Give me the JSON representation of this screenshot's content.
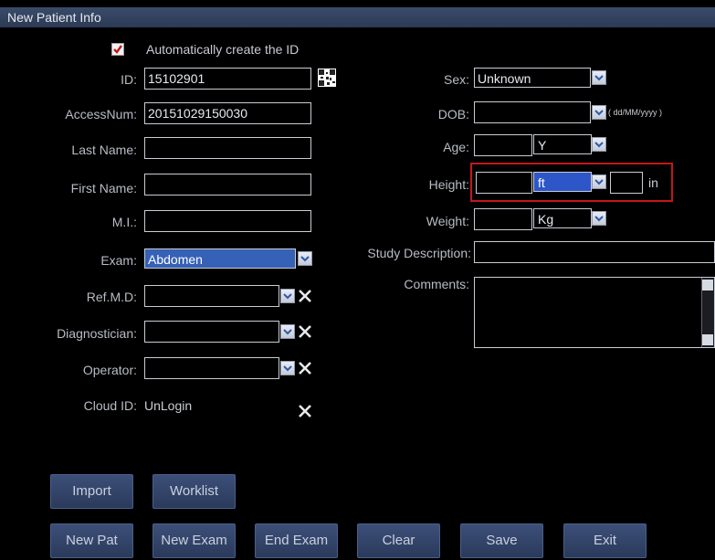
{
  "window": {
    "title": "New Patient Info"
  },
  "auto_id": {
    "label": "Automatically create the ID",
    "checked": true
  },
  "left": {
    "id": {
      "label": "ID:",
      "value": "15102901"
    },
    "access_num": {
      "label": "AccessNum:",
      "value": "20151029150030"
    },
    "last_name": {
      "label": "Last Name:",
      "value": ""
    },
    "first_name": {
      "label": "First Name:",
      "value": ""
    },
    "mi": {
      "label": "M.I.:",
      "value": ""
    },
    "exam": {
      "label": "Exam:",
      "value": "Abdomen"
    },
    "ref_md": {
      "label": "Ref.M.D:",
      "value": ""
    },
    "diagnostician": {
      "label": "Diagnostician:",
      "value": ""
    },
    "operator": {
      "label": "Operator:",
      "value": ""
    },
    "cloud_id": {
      "label": "Cloud ID:",
      "value": "UnLogin"
    }
  },
  "right": {
    "sex": {
      "label": "Sex:",
      "value": "Unknown"
    },
    "dob": {
      "label": "DOB:",
      "value": "",
      "format_hint": "( dd/MM/yyyy )"
    },
    "age": {
      "label": "Age:",
      "value": "",
      "unit": "Y"
    },
    "height": {
      "label": "Height:",
      "value_ft": "",
      "unit": "ft",
      "value_in": "",
      "in_label": "in"
    },
    "weight": {
      "label": "Weight:",
      "value": "",
      "unit": "Kg"
    },
    "study_description": {
      "label": "Study Description:",
      "value": ""
    },
    "comments": {
      "label": "Comments:",
      "value": ""
    }
  },
  "buttons": {
    "import": "Import",
    "worklist": "Worklist",
    "new_pat": "New Pat",
    "new_exam": "New Exam",
    "end_exam": "End Exam",
    "clear": "Clear",
    "save": "Save",
    "exit": "Exit"
  },
  "colors": {
    "accent": "#3561b6",
    "highlight_box": "#c4161c",
    "title_bar": "#2c3a55"
  }
}
